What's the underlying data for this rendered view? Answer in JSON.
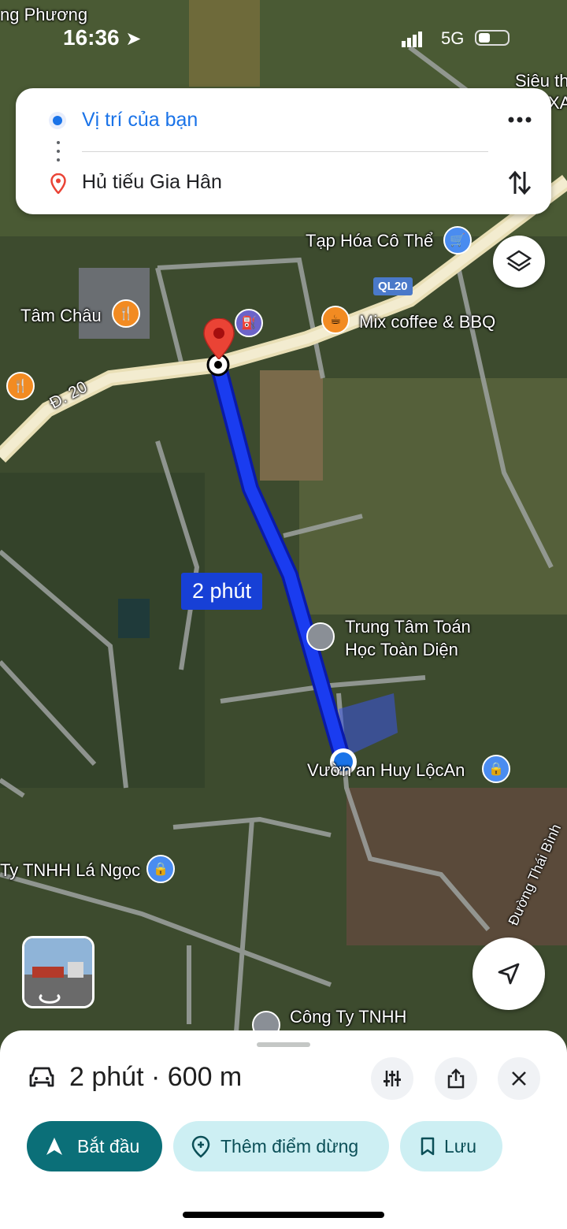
{
  "status_bar": {
    "time": "16:36",
    "network": "5G"
  },
  "route": {
    "origin": "Vị trí của bạn",
    "destination": "Hủ tiếu Gia Hân"
  },
  "map_labels": {
    "top_left_place": "ng Phương",
    "top_right_place_1": "Siêu th",
    "top_right_place_2": "XA",
    "grocery": "Tạp Hóa Cô Thể",
    "road_badge": "QL20",
    "tam_chau": "Tâm Châu",
    "mix_coffee": "Mix coffee & BBQ",
    "road_d20": "Đ. 20",
    "eta": "2 phút",
    "math_center_line1": "Trung Tâm Toán",
    "math_center_line2": "Học Toàn Diện",
    "vuon": "Vườn an Huy LộcAn",
    "la_ngoc": "Ty TNHH Lá Ngọc",
    "thai_binh": "Đường Thái Bình",
    "cong_ty": "Công Ty TNHH"
  },
  "sheet": {
    "summary": "2 phút · 600 m",
    "start_label": "Bắt đầu",
    "add_stop_label": "Thêm điểm dừng",
    "save_label": "Lưu"
  },
  "colors": {
    "route": "#1a3cf0",
    "accent": "#0b6f78",
    "origin_blue": "#1a73e8",
    "pin_red": "#ea4335"
  }
}
